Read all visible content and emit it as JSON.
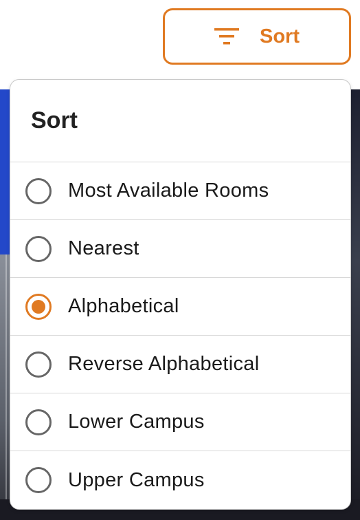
{
  "sort_button": {
    "label": "Sort",
    "icon": "filter-list-icon",
    "accent_color": "#e07a22"
  },
  "menu": {
    "title": "Sort",
    "selected_index": 2,
    "options": [
      {
        "label": "Most Available Rooms",
        "selected": false
      },
      {
        "label": "Nearest",
        "selected": false
      },
      {
        "label": "Alphabetical",
        "selected": true
      },
      {
        "label": "Reverse Alphabetical",
        "selected": false
      },
      {
        "label": "Lower Campus",
        "selected": false
      },
      {
        "label": "Upper Campus",
        "selected": false
      }
    ]
  }
}
